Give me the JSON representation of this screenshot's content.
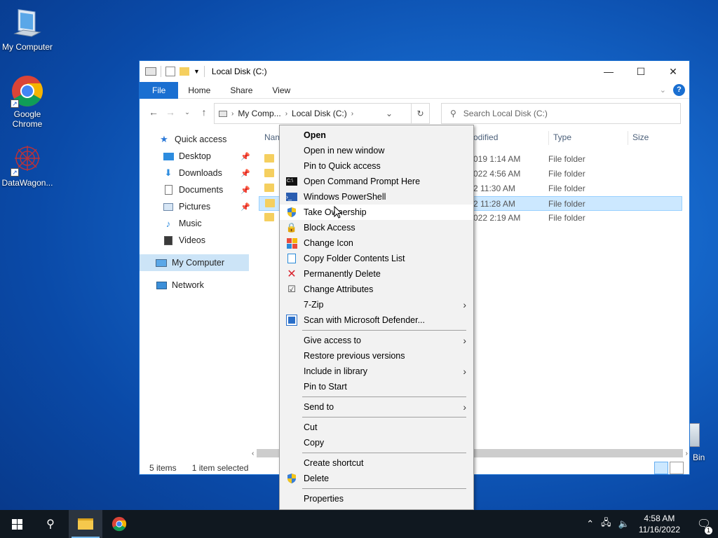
{
  "desktop": {
    "icons": [
      {
        "label": "My Computer"
      },
      {
        "label": "Google Chrome"
      },
      {
        "label": "DataWagon..."
      }
    ],
    "recycle_bin_partial": "Bin"
  },
  "window": {
    "title": "Local Disk (C:)",
    "ribbon_tabs": [
      "File",
      "Home",
      "Share",
      "View"
    ],
    "help_glyph": "?",
    "address": {
      "crumbs": [
        "My Comp...",
        "Local Disk (C:)"
      ]
    },
    "search_placeholder": "Search Local Disk (C:)"
  },
  "navpane": {
    "quick_access": "Quick access",
    "items": [
      {
        "label": "Desktop",
        "pinned": true
      },
      {
        "label": "Downloads",
        "pinned": true
      },
      {
        "label": "Documents",
        "pinned": true
      },
      {
        "label": "Pictures",
        "pinned": true
      },
      {
        "label": "Music",
        "pinned": false
      },
      {
        "label": "Videos",
        "pinned": false
      }
    ],
    "my_computer": "My Computer",
    "network": "Network"
  },
  "content": {
    "columns": {
      "name": "Nam",
      "modified": "odified",
      "type": "Type",
      "size": "Size"
    },
    "rows": [
      {
        "modified": "019 1:14 AM",
        "type": "File folder"
      },
      {
        "modified": "022 4:56 AM",
        "type": "File folder"
      },
      {
        "modified": "2 11:30 AM",
        "type": "File folder"
      },
      {
        "modified": "2 11:28 AM",
        "type": "File folder",
        "selected": true
      },
      {
        "modified": "022 2:19 AM",
        "type": "File folder"
      }
    ]
  },
  "status": {
    "items": "5 items",
    "selected": "1 item selected"
  },
  "context_menu": {
    "group1": [
      {
        "label": "Open",
        "bold": true,
        "icon": ""
      },
      {
        "label": "Open in new window",
        "icon": ""
      },
      {
        "label": "Pin to Quick access",
        "icon": ""
      },
      {
        "label": "Open Command Prompt Here",
        "icon": "cmd-icon"
      },
      {
        "label": "Windows PowerShell",
        "icon": "powershell-icon"
      },
      {
        "label": "Take Ownership",
        "icon": "shield-icon",
        "hovered": true
      },
      {
        "label": "Block Access",
        "icon": "lock-icon"
      },
      {
        "label": "Change Icon",
        "icon": "change-icon-icon"
      },
      {
        "label": "Copy Folder Contents List",
        "icon": "copy-list-icon"
      },
      {
        "label": "Permanently Delete",
        "icon": "red-x-icon"
      },
      {
        "label": "Change Attributes",
        "icon": "check-icon"
      },
      {
        "label": "7-Zip",
        "icon": "",
        "submenu": true
      },
      {
        "label": "Scan with Microsoft Defender...",
        "icon": "defender-icon"
      }
    ],
    "group2": [
      {
        "label": "Give access to",
        "submenu": true
      },
      {
        "label": "Restore previous versions"
      },
      {
        "label": "Include in library",
        "submenu": true
      },
      {
        "label": "Pin to Start"
      }
    ],
    "group3": [
      {
        "label": "Send to",
        "submenu": true
      }
    ],
    "group4": [
      {
        "label": "Cut"
      },
      {
        "label": "Copy"
      }
    ],
    "group5": [
      {
        "label": "Create shortcut"
      },
      {
        "label": "Delete",
        "icon": "shield-icon"
      }
    ],
    "group6": [
      {
        "label": "Properties"
      }
    ]
  },
  "taskbar": {
    "time": "4:58 AM",
    "date": "11/16/2022",
    "notification_count": "1"
  }
}
